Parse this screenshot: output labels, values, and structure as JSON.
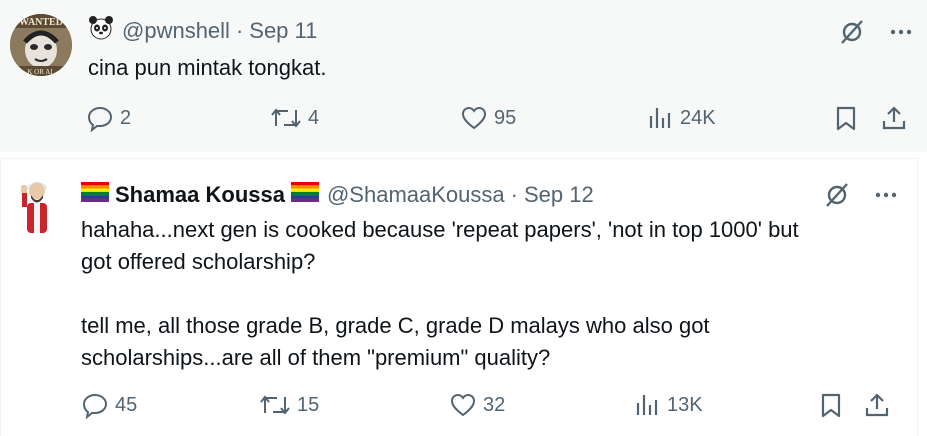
{
  "tweet1": {
    "avatar_text": "WANTED",
    "avatar_subtext": "K OR AL",
    "username": "@pwnshell",
    "separator": "·",
    "date": "Sep 11",
    "text": "cina pun mintak tongkat.",
    "stats": {
      "replies": "2",
      "reposts": "4",
      "likes": "95",
      "views": "24K"
    }
  },
  "tweet2": {
    "display_name": "Shamaa Koussa",
    "username": "@ShamaaKoussa",
    "separator": "·",
    "date": "Sep 12",
    "text": "hahaha...next gen is cooked because 'repeat papers', 'not in top 1000' but\ngot offered scholarship?\n\ntell me, all those grade B, grade C, grade D malays who also got\nscholarships...are all of them \"premium\" quality?",
    "stats": {
      "replies": "45",
      "reposts": "15",
      "likes": "32",
      "views": "13K"
    }
  },
  "icons": {
    "panda": "panda-icon",
    "rainbow_flag": "rainbow-flag-icon",
    "grok": "grok-icon",
    "more": "more-icon",
    "reply": "reply-icon",
    "repost": "repost-icon",
    "like": "like-icon",
    "views": "views-icon",
    "bookmark": "bookmark-icon",
    "share": "share-icon"
  },
  "colors": {
    "text": "#0f1419",
    "secondary": "#536471",
    "background_highlight": "#f7f9f9"
  }
}
